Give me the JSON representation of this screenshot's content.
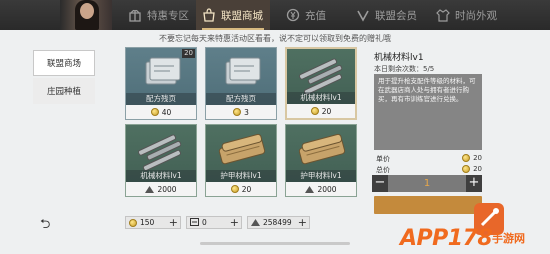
{
  "topbar": {
    "tabs": [
      {
        "label": "特惠专区",
        "icon": "gift-icon"
      },
      {
        "label": "联盟商城",
        "icon": "shop-icon"
      },
      {
        "label": "充值",
        "icon": "recharge-icon"
      },
      {
        "label": "联盟会员",
        "icon": "vip-icon"
      },
      {
        "label": "时尚外观",
        "icon": "fashion-icon"
      }
    ],
    "active_tab": "联盟商城"
  },
  "notice": "不要忘记每天来特惠活动区看看，说不定可以领取到免费的赠礼哦",
  "sidebar": {
    "items": [
      {
        "label": "联盟商场",
        "active": true
      },
      {
        "label": "庄园种植",
        "active": false
      }
    ]
  },
  "items": [
    {
      "name": "配方残页",
      "price": "40",
      "currency": "coin",
      "badge": "20",
      "kind": "blueprint"
    },
    {
      "name": "配方残页",
      "price": "3",
      "currency": "coin",
      "badge": "",
      "kind": "blueprint"
    },
    {
      "name": "机械材料lv1",
      "price": "20",
      "currency": "coin",
      "badge": "",
      "kind": "parts",
      "selected": true
    },
    {
      "name": "机械材料lv1",
      "price": "2000",
      "currency": "alliance",
      "badge": "",
      "kind": "parts"
    },
    {
      "name": "护甲材料lv1",
      "price": "20",
      "currency": "coin",
      "badge": "",
      "kind": "cloth"
    },
    {
      "name": "护甲材料lv1",
      "price": "2000",
      "currency": "alliance",
      "badge": "",
      "kind": "cloth"
    }
  ],
  "detail": {
    "title": "机械材料lv1",
    "remaining": "本日剩余次数：5/5",
    "description": "用于提升枪支配件等级的材料，可在武器店商人处与拥有者进行购买，再有市训练官进行兑换。",
    "unit_price_label": "单价",
    "unit_price": "20",
    "total_label": "总价",
    "total": "20",
    "quantity": "1",
    "minus": "−",
    "plus": "+"
  },
  "currencies": [
    {
      "value": "150",
      "icon": "coin-icon"
    },
    {
      "value": "0",
      "icon": "ticket-icon"
    },
    {
      "value": "258499",
      "icon": "alliance-coin-icon"
    }
  ],
  "back_label": "⮌",
  "watermark": {
    "main": "APP178",
    "sub": "手游网"
  },
  "colors": {
    "accent": "#d7b980",
    "price_coin": "#c9a02a",
    "watermark": "#f06a1e"
  }
}
